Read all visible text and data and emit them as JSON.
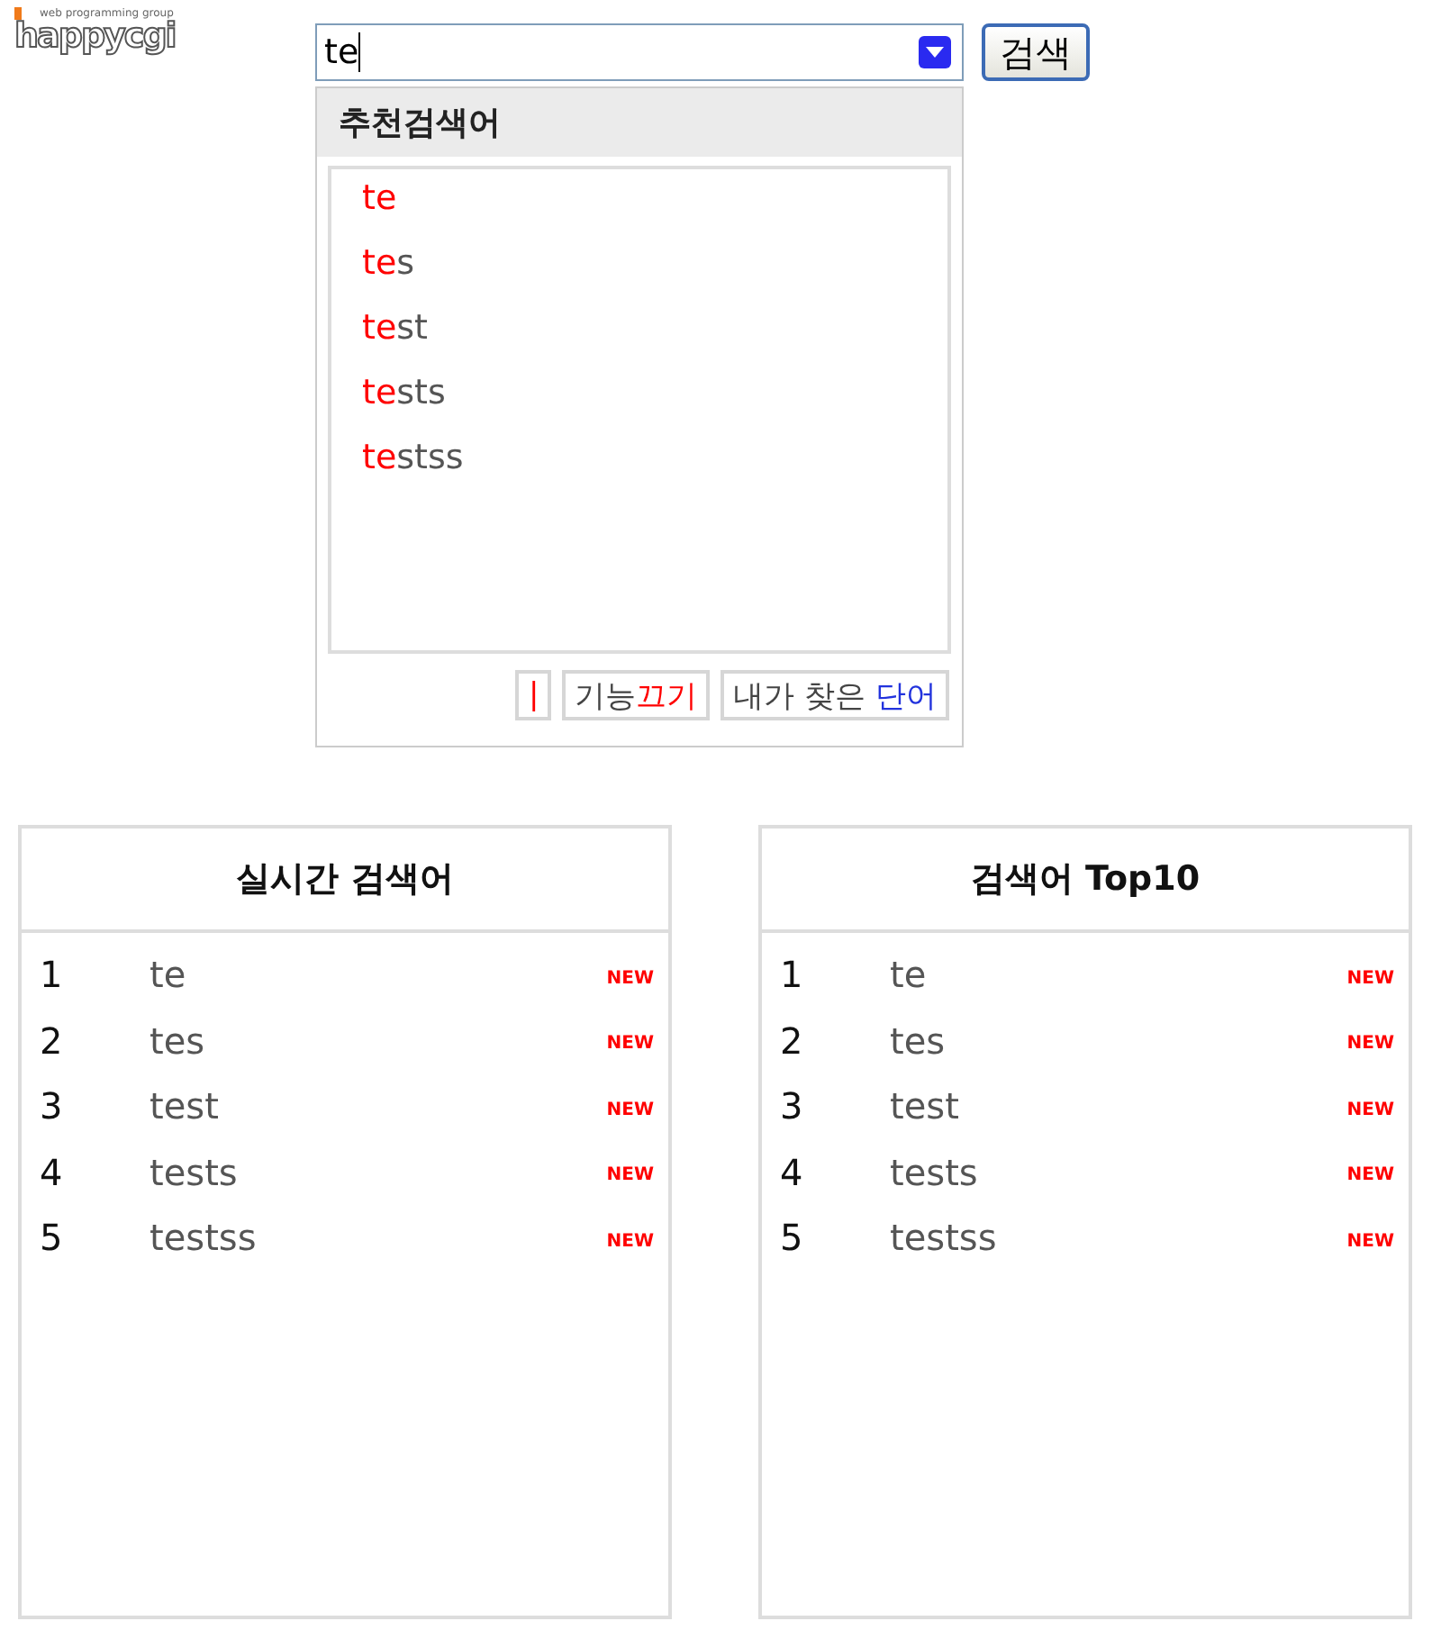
{
  "logo": {
    "name": "happycgi",
    "tagline": "web programming group"
  },
  "search": {
    "value": "te",
    "button": "검색"
  },
  "suggest": {
    "title": "추천검색어",
    "items": [
      {
        "match": "te"
      },
      {
        "match": "te",
        "rest": "s"
      },
      {
        "match": "te",
        "rest": "st"
      },
      {
        "match": "te",
        "rest": "sts"
      },
      {
        "match": "te",
        "rest": "stss"
      }
    ],
    "buttons": [
      {
        "parts": [
          {
            "text": "|",
            "color": "#ff0000"
          }
        ]
      },
      {
        "parts": [
          {
            "text": "기능",
            "color": "#444444"
          },
          {
            "text": "끄기",
            "color": "#ff0000"
          }
        ]
      },
      {
        "parts": [
          {
            "text": "내가 찾은 ",
            "color": "#444444"
          },
          {
            "text": "단어",
            "color": "#2233dd"
          }
        ]
      }
    ]
  },
  "panels": [
    {
      "title": "실시간 검색어",
      "rows": [
        {
          "rank": "1",
          "word": "te",
          "badge": "NEW"
        },
        {
          "rank": "2",
          "word": "tes",
          "badge": "NEW"
        },
        {
          "rank": "3",
          "word": "test",
          "badge": "NEW"
        },
        {
          "rank": "4",
          "word": "tests",
          "badge": "NEW"
        },
        {
          "rank": "5",
          "word": "testss",
          "badge": "NEW"
        }
      ]
    },
    {
      "title": "검색어 Top10",
      "rows": [
        {
          "rank": "1",
          "word": "te",
          "badge": "NEW"
        },
        {
          "rank": "2",
          "word": "tes",
          "badge": "NEW"
        },
        {
          "rank": "3",
          "word": "test",
          "badge": "NEW"
        },
        {
          "rank": "4",
          "word": "tests",
          "badge": "NEW"
        },
        {
          "rank": "5",
          "word": "testss",
          "badge": "NEW"
        }
      ]
    }
  ]
}
